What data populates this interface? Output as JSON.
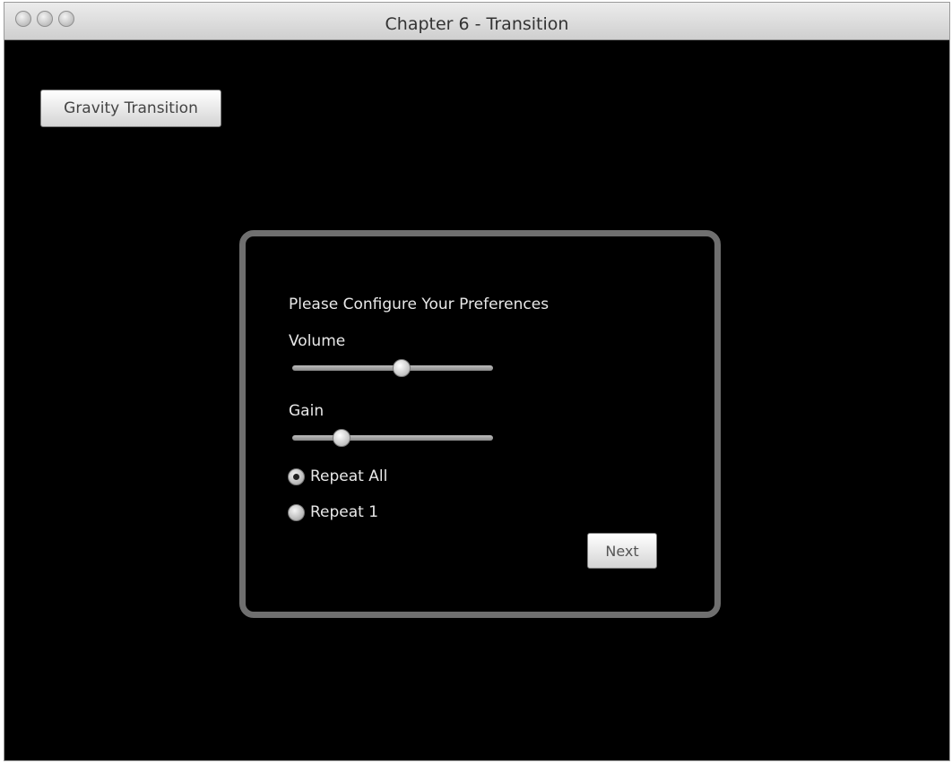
{
  "window": {
    "title": "Chapter 6 - Transition"
  },
  "toolbar": {
    "gravity_label": "Gravity Transition"
  },
  "panel": {
    "heading": "Please Configure Your Preferences",
    "volume_label": "Volume",
    "volume_value": 0.55,
    "gain_label": "Gain",
    "gain_value": 0.22,
    "repeat_all_label": "Repeat All",
    "repeat_all_selected": true,
    "repeat_one_label": "Repeat 1",
    "repeat_one_selected": false,
    "next_label": "Next"
  }
}
